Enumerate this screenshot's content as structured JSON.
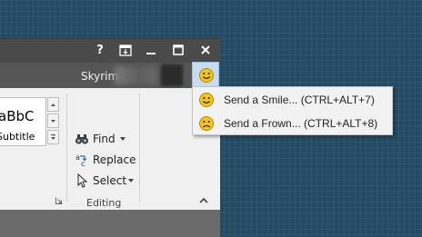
{
  "window": {
    "title_buttons": [
      {
        "name": "help",
        "label": "?"
      },
      {
        "name": "ribbon-display-options",
        "icon": "ribbon-display-icon"
      },
      {
        "name": "minimize",
        "icon": "minimize-icon"
      },
      {
        "name": "maximize",
        "icon": "maximize-icon"
      },
      {
        "name": "close",
        "icon": "close-icon"
      }
    ],
    "user": {
      "name": "Skyrim"
    }
  },
  "ribbon": {
    "styles": {
      "normal_preview": "aBbC",
      "subtitle_preview": "Subtitle"
    },
    "editing_group": {
      "label": "Editing",
      "find": "Find",
      "replace": "Replace",
      "select": "Select"
    }
  },
  "feedback": {
    "button_icon": "smiley-icon",
    "menu": [
      {
        "label": "Send a Smile... (CTRL+ALT+7)",
        "icon": "smiley-icon"
      },
      {
        "label": "Send a Frown... (CTRL+ALT+8)",
        "icon": "frown-icon"
      }
    ]
  },
  "colors": {
    "desktop": "#234b63",
    "titlebar": "#4a4a4a",
    "ribbon": "#f0f0f0",
    "highlight": "#c7dcf1",
    "face": "#f5c518"
  }
}
